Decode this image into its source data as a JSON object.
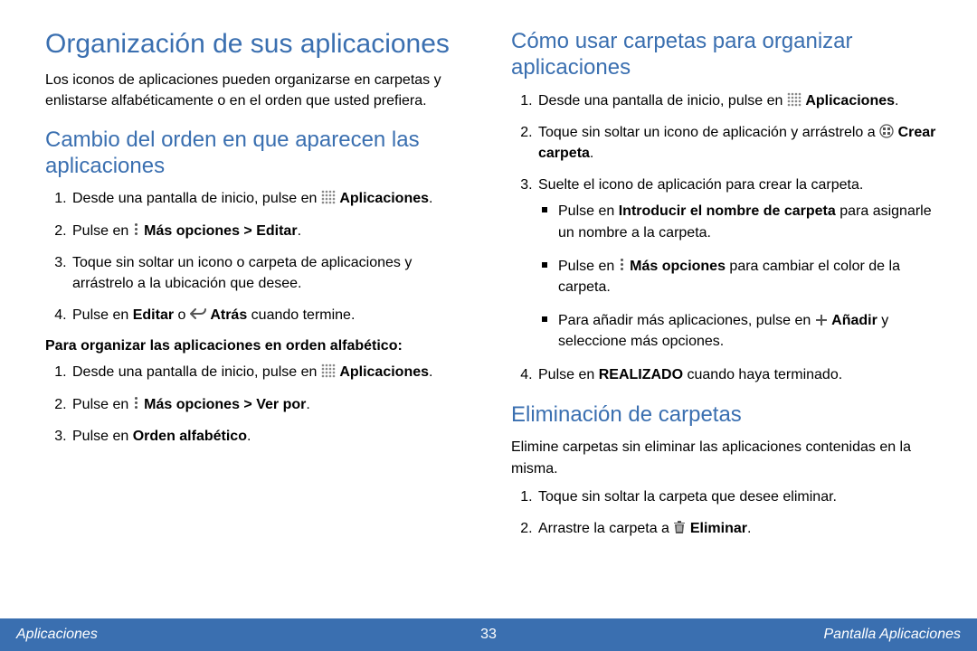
{
  "left": {
    "title": "Organización de sus aplicaciones",
    "intro": "Los iconos de aplicaciones pueden organizarse en carpetas y enlistarse alfabéticamente o en el orden que usted prefiera.",
    "section1_title": "Cambio del orden en que aparecen las aplicaciones",
    "s1_li1a": "Desde una pantalla de inicio, pulse en ",
    "s1_li1b": "Aplicaciones",
    "s1_li1c": ".",
    "s1_li2a": "Pulse en ",
    "s1_li2b": "Más opciones > Editar",
    "s1_li2c": ".",
    "s1_li3": "Toque sin soltar un icono o carpeta de aplicaciones y arrástrelo a la ubicación que desee.",
    "s1_li4a": "Pulse en ",
    "s1_li4b": "Editar",
    "s1_li4c": " o ",
    "s1_li4d": "Atrás",
    "s1_li4e": " cuando termine.",
    "alpha_heading": "Para organizar las aplicaciones en orden alfabético:",
    "a_li1a": "Desde una pantalla de inicio, pulse en ",
    "a_li1b": "Aplicaciones",
    "a_li1c": ".",
    "a_li2a": "Pulse en ",
    "a_li2b": "Más opciones > Ver por",
    "a_li2c": ".",
    "a_li3a": "Pulse en ",
    "a_li3b": "Orden alfabético",
    "a_li3c": "."
  },
  "right": {
    "title": "Cómo usar carpetas para organizar aplicaciones",
    "r_li1a": "Desde una pantalla de inicio, pulse en ",
    "r_li1b": "Aplicaciones",
    "r_li1c": ".",
    "r_li2a": "Toque sin soltar un icono de aplicación y arrástrelo a ",
    "r_li2b": "Crear carpeta",
    "r_li2c": ".",
    "r_li3": "Suelte el icono de aplicación para crear la carpeta.",
    "b1a": "Pulse en ",
    "b1b": "Introducir el nombre de carpeta",
    "b1c": " para asignarle un nombre a la carpeta.",
    "b2a": "Pulse en ",
    "b2b": "Más opciones",
    "b2c": " para cambiar el color de la carpeta.",
    "b3a": "Para añadir más aplicaciones, pulse en ",
    "b3b": "Añadir",
    "b3c": " y seleccione más opciones.",
    "r_li4a": "Pulse en ",
    "r_li4b": "REALIZADO",
    "r_li4c": " cuando haya terminado.",
    "del_title": "Eliminación de carpetas",
    "del_intro": "Elimine carpetas sin eliminar las aplicaciones contenidas en la misma.",
    "d_li1": "Toque sin soltar la carpeta que desee eliminar.",
    "d_li2a": "Arrastre la carpeta a ",
    "d_li2b": "Eliminar",
    "d_li2c": "."
  },
  "footer": {
    "left": "Aplicaciones",
    "page": "33",
    "right": "Pantalla Aplicaciones"
  }
}
